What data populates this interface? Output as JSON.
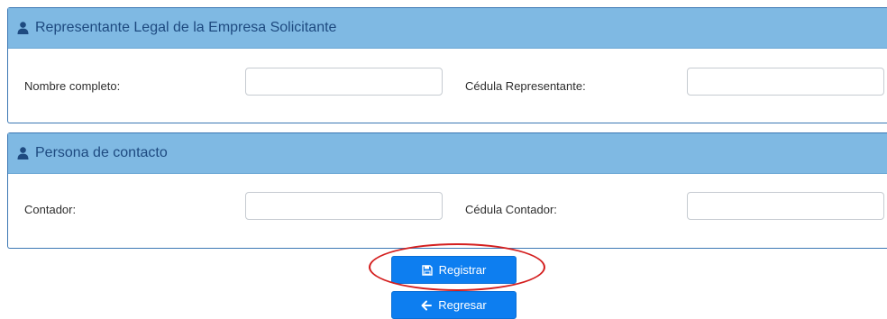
{
  "sections": [
    {
      "title": "Representante Legal de la Empresa Solicitante",
      "icon": "user-icon",
      "fields": [
        {
          "label": "Nombre completo:",
          "value": ""
        },
        {
          "label": "Cédula Representante:",
          "value": ""
        }
      ]
    },
    {
      "title": "Persona de contacto",
      "icon": "user-icon",
      "fields": [
        {
          "label": "Contador:",
          "value": ""
        },
        {
          "label": "Cédula Contador:",
          "value": ""
        }
      ]
    }
  ],
  "buttons": {
    "register": {
      "label": "Registrar",
      "icon": "save-icon"
    },
    "back": {
      "label": "Regresar",
      "icon": "arrow-left-icon"
    }
  },
  "colors": {
    "panel_heading": "#7fb9e3",
    "panel_border": "#3c78b4",
    "title_text": "#1e4a80",
    "button": "#0d7ef0",
    "highlight": "#d41f1f"
  }
}
